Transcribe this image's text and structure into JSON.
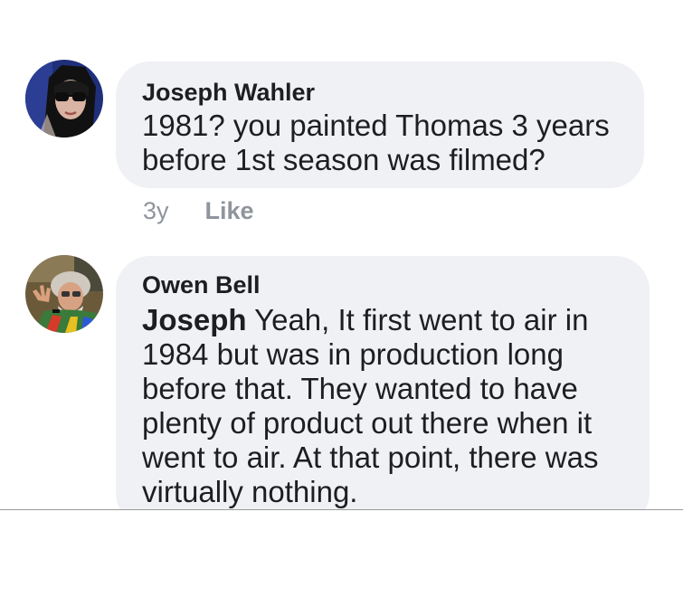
{
  "comments": [
    {
      "author": "Joseph Wahler",
      "text_line1": "1981? you painted Thomas 3 years",
      "text_line2": "before 1st season was filmed?",
      "time": "3y",
      "like_label": "Like",
      "avatar_icon": "profile-photo-sunglasses"
    },
    {
      "author": "Owen Bell",
      "mention": "Joseph",
      "text_line1_rest": " Yeah, It first went to air in",
      "text_line2": "1984 but was in production long",
      "text_line3": "before that. They wanted to have",
      "text_line4": "plenty of product out there when it",
      "text_line5": "went to air. At that point, there was",
      "text_line6": "virtually nothing.",
      "avatar_icon": "profile-photo-man-waving"
    }
  ],
  "colors": {
    "bubble": "#f0f1f4",
    "meta_text": "#90949c",
    "text": "#1c1e21"
  }
}
